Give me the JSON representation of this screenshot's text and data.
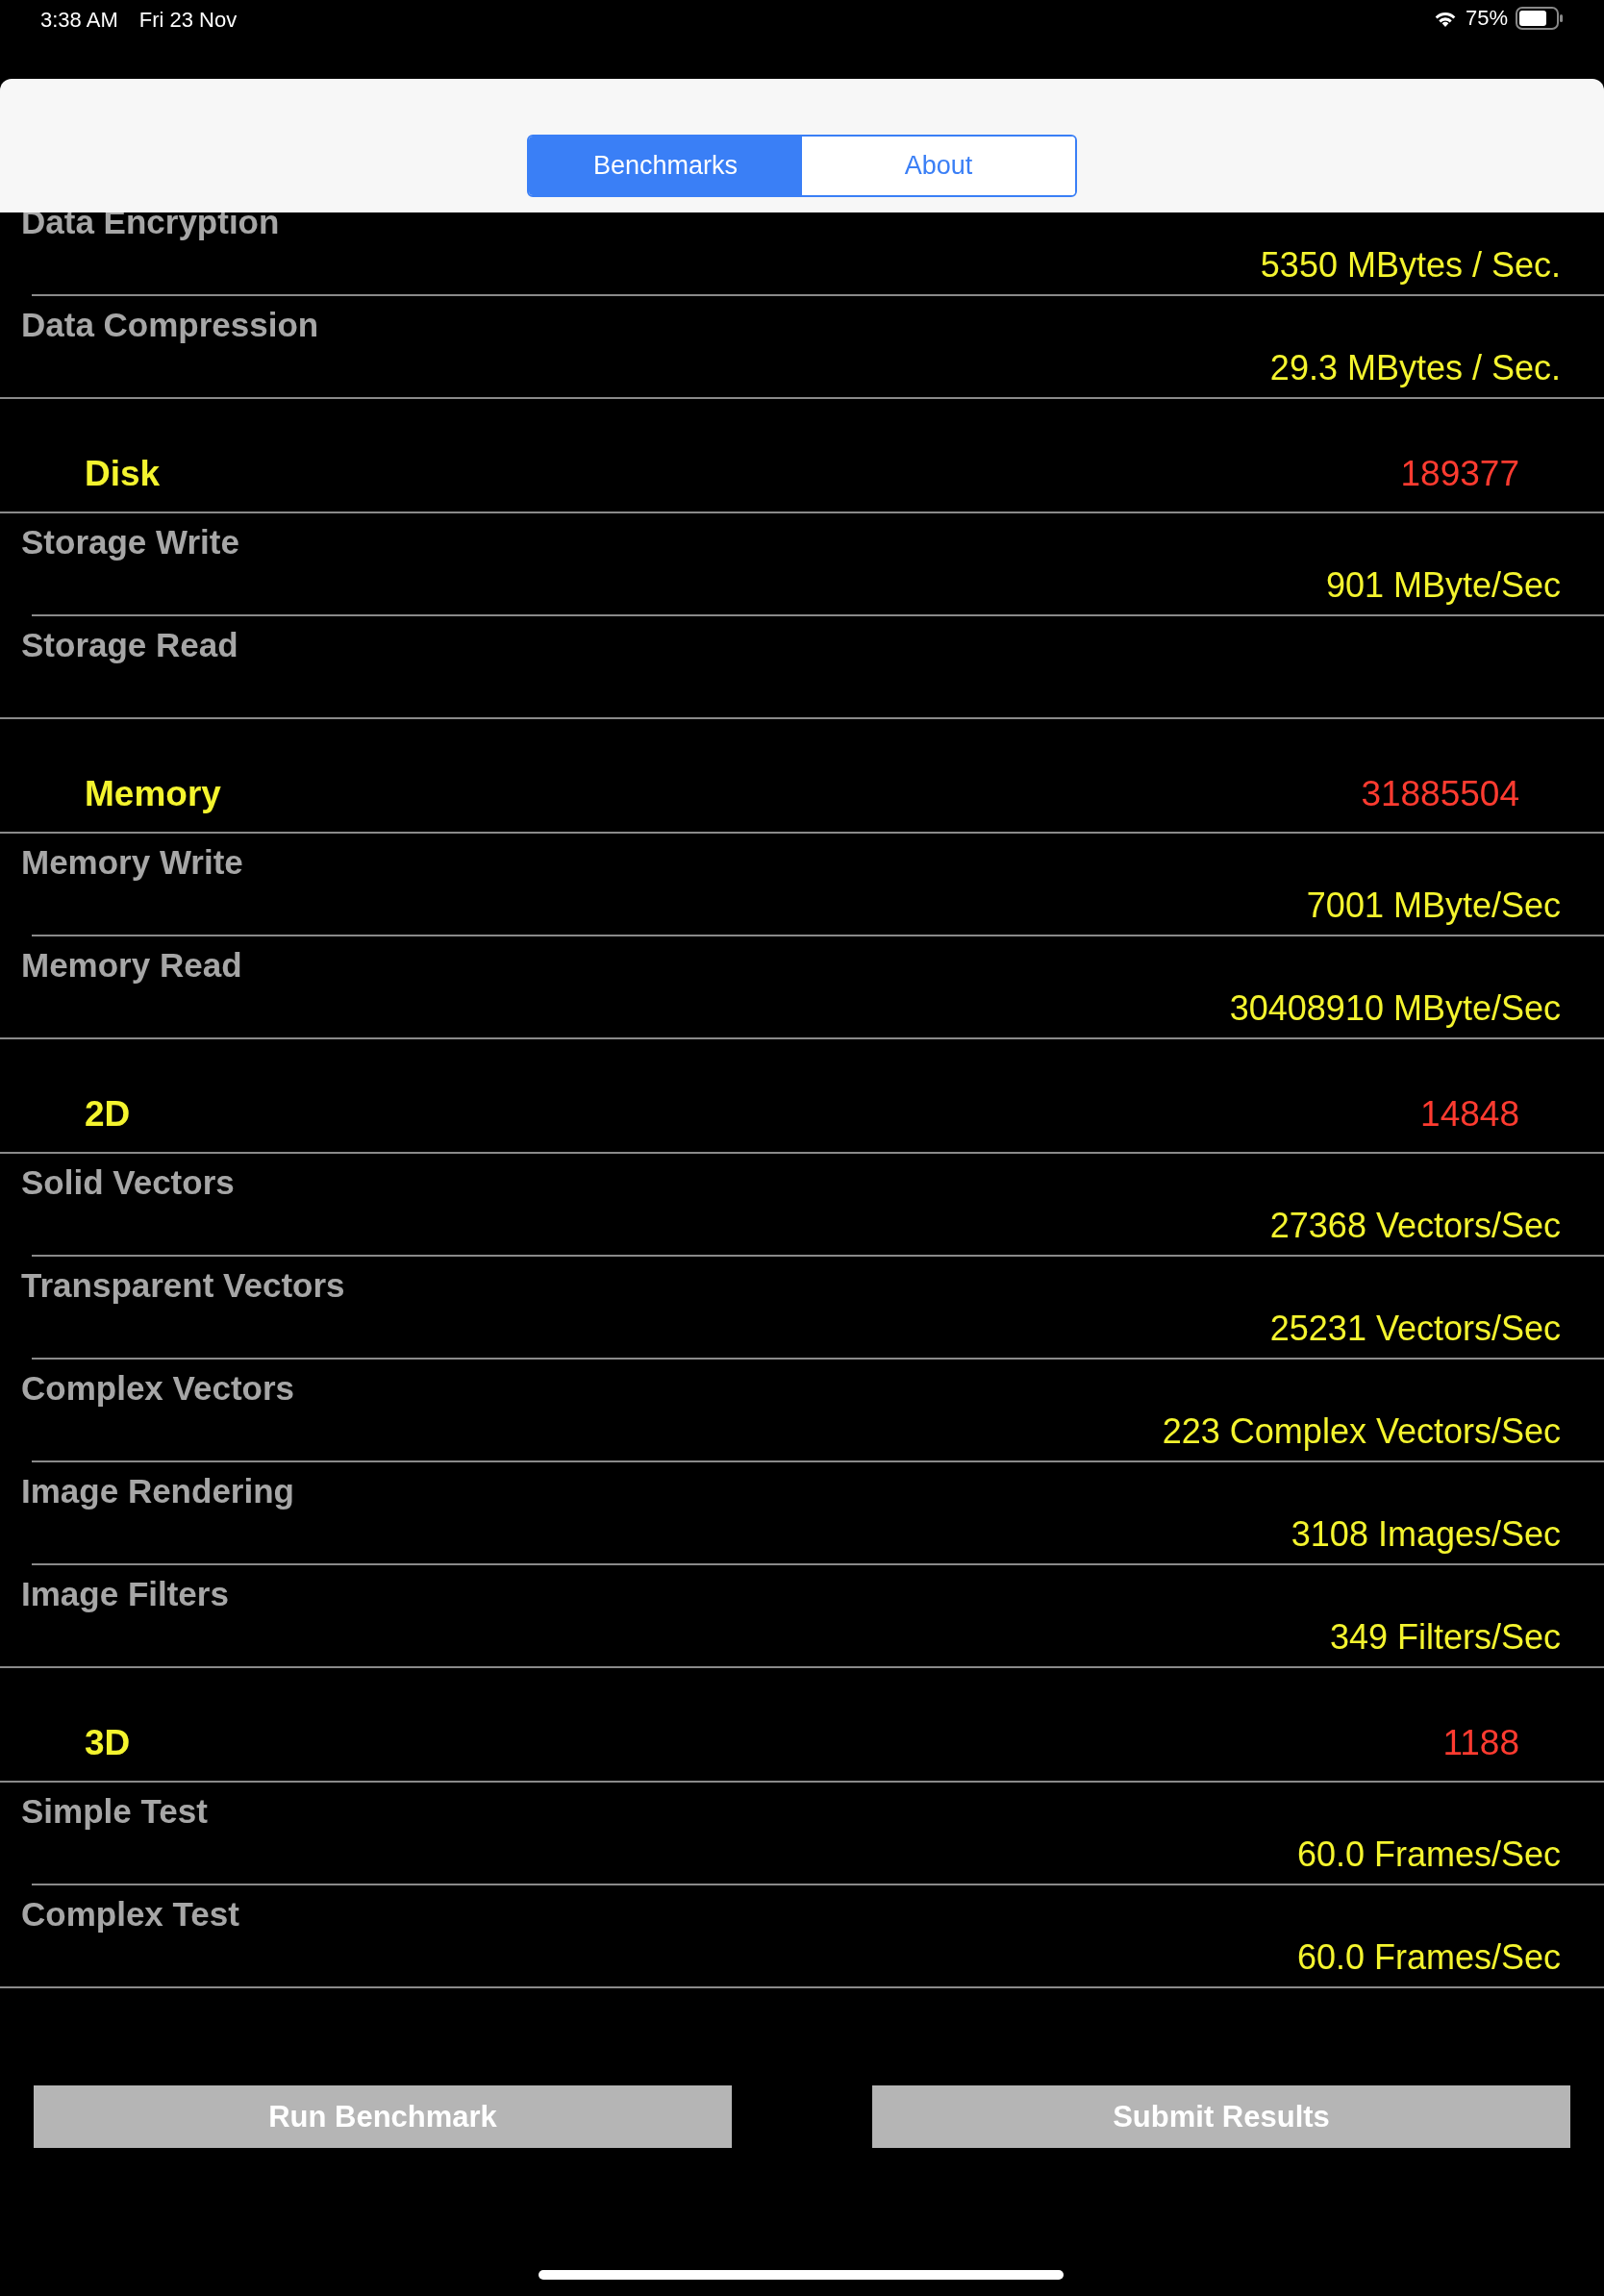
{
  "status_bar": {
    "time": "3:38 AM",
    "date": "Fri 23 Nov",
    "battery": "75%"
  },
  "tabs": [
    {
      "label": "Benchmarks",
      "selected": true
    },
    {
      "label": "About",
      "selected": false
    }
  ],
  "sections": [
    {
      "items": [
        {
          "label": "Data Encryption",
          "value": "5350 MBytes / Sec."
        },
        {
          "label": "Data Compression",
          "value": "29.3 MBytes / Sec."
        }
      ]
    },
    {
      "title": "Disk",
      "score": "189377",
      "items": [
        {
          "label": "Storage Write",
          "value": "901 MByte/Sec"
        },
        {
          "label": "Storage Read"
        }
      ]
    },
    {
      "title": "Memory",
      "score": "31885504",
      "items": [
        {
          "label": "Memory Write",
          "value": "7001 MByte/Sec"
        },
        {
          "label": "Memory Read",
          "value": "30408910 MByte/Sec"
        }
      ]
    },
    {
      "title": "2D",
      "score": "14848",
      "items": [
        {
          "label": "Solid Vectors",
          "value": "27368 Vectors/Sec"
        },
        {
          "label": "Transparent Vectors",
          "value": "25231 Vectors/Sec"
        },
        {
          "label": "Complex Vectors",
          "value": "223 Complex Vectors/Sec"
        },
        {
          "label": "Image Rendering",
          "value": "3108 Images/Sec"
        },
        {
          "label": "Image Filters",
          "value": "349 Filters/Sec"
        }
      ]
    },
    {
      "title": "3D",
      "score": "1188",
      "items": [
        {
          "label": "Simple Test",
          "value": "60.0 Frames/Sec"
        },
        {
          "label": "Complex Test",
          "value": "60.0 Frames/Sec"
        }
      ]
    }
  ],
  "buttons": [
    "Run Benchmark",
    "Submit Results"
  ]
}
